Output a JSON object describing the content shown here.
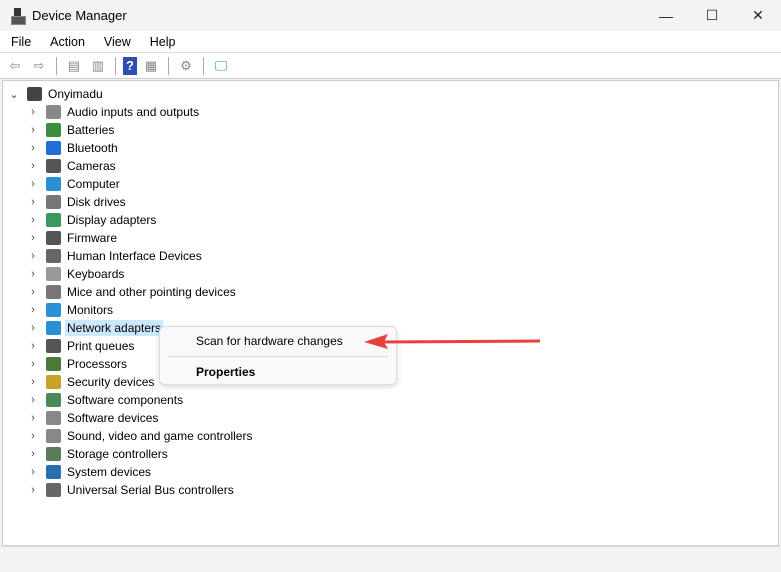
{
  "window": {
    "title": "Device Manager",
    "minimize": "—",
    "maximize": "☐",
    "close": "✕"
  },
  "menus": [
    "File",
    "Action",
    "View",
    "Help"
  ],
  "toolbar": [
    {
      "icon": "back-icon",
      "g": "⇦"
    },
    {
      "icon": "forward-icon",
      "g": "⇨"
    },
    {
      "icon": "show-hide-console-tree-icon",
      "g": "▤"
    },
    {
      "icon": "properties-icon",
      "g": "▥"
    },
    {
      "icon": "help-icon",
      "g": "?"
    },
    {
      "icon": "action-pane-icon",
      "g": "▦"
    },
    {
      "icon": "update-driver-icon",
      "g": "⚙"
    },
    {
      "icon": "scan-hardware-icon",
      "g": "🖵"
    }
  ],
  "tree": {
    "root": "Onyimadu",
    "items": [
      {
        "label": "Audio inputs and outputs",
        "color": "#888"
      },
      {
        "label": "Batteries",
        "color": "#3a8f3a"
      },
      {
        "label": "Bluetooth",
        "color": "#1e6fd9"
      },
      {
        "label": "Cameras",
        "color": "#555"
      },
      {
        "label": "Computer",
        "color": "#2a8fd6"
      },
      {
        "label": "Disk drives",
        "color": "#777"
      },
      {
        "label": "Display adapters",
        "color": "#3b9a5b"
      },
      {
        "label": "Firmware",
        "color": "#555"
      },
      {
        "label": "Human Interface Devices",
        "color": "#666"
      },
      {
        "label": "Keyboards",
        "color": "#999"
      },
      {
        "label": "Mice and other pointing devices",
        "color": "#777"
      },
      {
        "label": "Monitors",
        "color": "#2a8fd6"
      },
      {
        "label": "Network adapters",
        "color": "#2a8fd6"
      },
      {
        "label": "Print queues",
        "color": "#555"
      },
      {
        "label": "Processors",
        "color": "#4a7a3a"
      },
      {
        "label": "Security devices",
        "color": "#c9a227"
      },
      {
        "label": "Software components",
        "color": "#4a8a5a"
      },
      {
        "label": "Software devices",
        "color": "#888"
      },
      {
        "label": "Sound, video and game controllers",
        "color": "#888"
      },
      {
        "label": "Storage controllers",
        "color": "#5a7a5a"
      },
      {
        "label": "System devices",
        "color": "#2a6fb0"
      },
      {
        "label": "Universal Serial Bus controllers",
        "color": "#666"
      }
    ]
  },
  "context_menu": {
    "scan": "Scan for hardware changes",
    "properties": "Properties"
  },
  "colors": {
    "annotation_arrow": "#e8403f",
    "selection": "#cce8ff"
  }
}
